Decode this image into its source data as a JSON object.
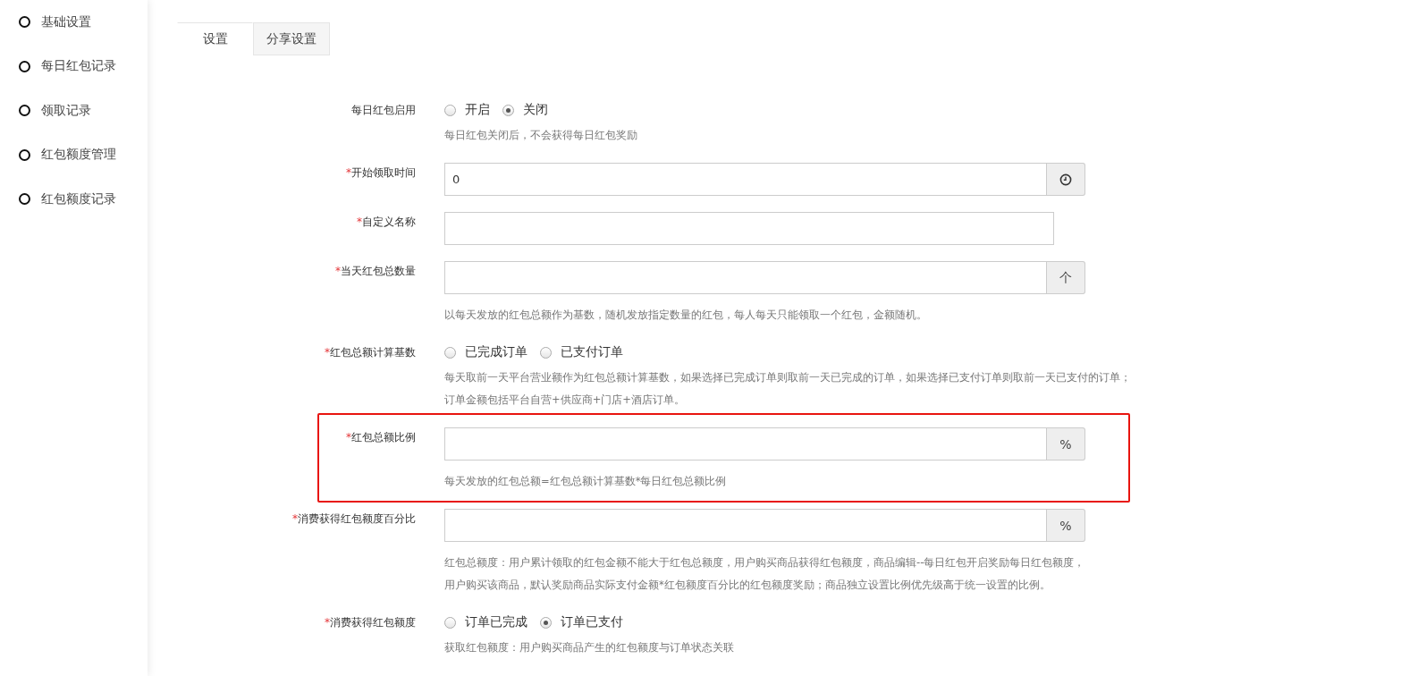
{
  "sidebar": {
    "items": [
      {
        "label": "基础设置"
      },
      {
        "label": "每日红包记录"
      },
      {
        "label": "领取记录"
      },
      {
        "label": "红包额度管理"
      },
      {
        "label": "红包额度记录"
      }
    ]
  },
  "tabs": [
    {
      "label": "设置",
      "selected": true
    },
    {
      "label": "分享设置",
      "selected": false
    }
  ],
  "form": {
    "rows": [
      {
        "kind": "radio",
        "label": "每日红包启用",
        "highlighted": false,
        "options": [
          {
            "label": "开启",
            "selected": false
          },
          {
            "label": "关闭",
            "selected": true
          }
        ],
        "hints": [
          "每日红包关闭后，不会获得每日红包奖励"
        ]
      },
      {
        "kind": "input",
        "label": "开始领取时间",
        "required_mark": "*",
        "highlighted": false,
        "value": "0",
        "addon": {
          "kind": "clock"
        }
      },
      {
        "kind": "input",
        "label": "自定义名称",
        "required_mark": "*",
        "highlighted": false
      },
      {
        "kind": "input",
        "label": "当天红包总数量",
        "required_mark": "*",
        "highlighted": false,
        "addon": {
          "kind": "text",
          "text": "个"
        },
        "hints": [
          "以每天发放的红包总额作为基数，随机发放指定数量的红包，每人每天只能领取一个红包，金额随机。"
        ]
      },
      {
        "kind": "radio",
        "label": "红包总额计算基数",
        "required_mark": "*",
        "highlighted": false,
        "options": [
          {
            "label": "已完成订单",
            "selected": false
          },
          {
            "label": "已支付订单",
            "selected": false
          }
        ],
        "hints": [
          "每天取前一天平台营业额作为红包总额计算基数，如果选择已完成订单则取前一天已完成的订单，如果选择已支付订单则取前一天已支付的订单；",
          "订单金额包括平台自营+供应商+门店+酒店订单。"
        ]
      },
      {
        "kind": "input",
        "label": "红包总额比例",
        "required_mark": "*",
        "highlighted": true,
        "addon": {
          "kind": "text",
          "text": "%"
        },
        "hints": [
          "每天发放的红包总额=红包总额计算基数*每日红包总额比例"
        ]
      },
      {
        "kind": "input",
        "label": "消费获得红包额度百分比",
        "required_mark": "*",
        "highlighted": false,
        "addon": {
          "kind": "text",
          "text": "%"
        },
        "hints": [
          "红包总额度：用户累计领取的红包金额不能大于红包总额度，用户购买商品获得红包额度，商品编辑--每日红包开启奖励每日红包额度，",
          "用户购买该商品，默认奖励商品实际支付金额*红包额度百分比的红包额度奖励；商品独立设置比例优先级高于统一设置的比例。"
        ]
      },
      {
        "kind": "radio",
        "label": "消费获得红包额度",
        "required_mark": "*",
        "highlighted": false,
        "options": [
          {
            "label": "订单已完成",
            "selected": false
          },
          {
            "label": "订单已支付",
            "selected": true
          }
        ],
        "hints": [
          "获取红包额度：用户购买商品产生的红包额度与订单状态关联"
        ]
      }
    ]
  }
}
